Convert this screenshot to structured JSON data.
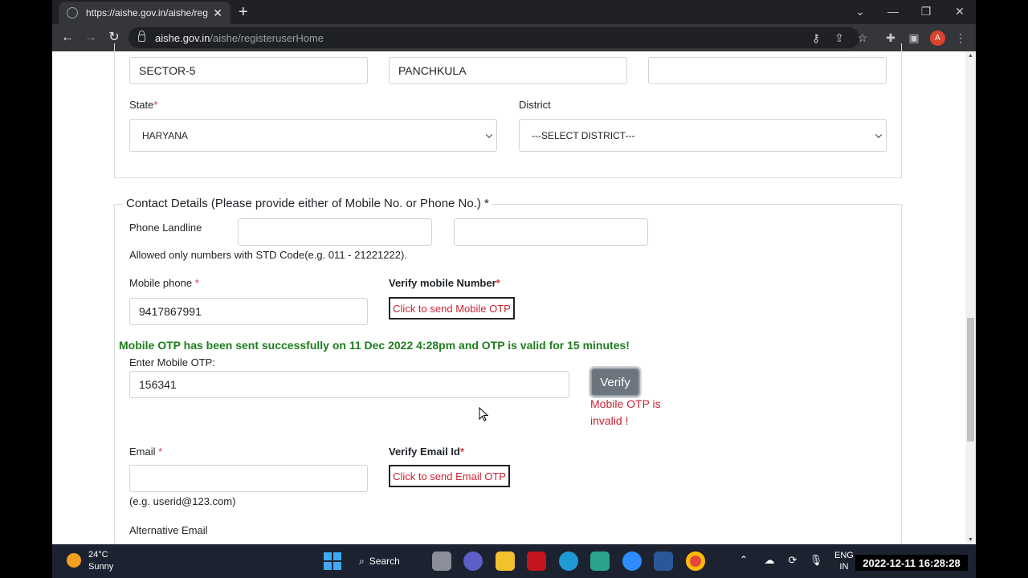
{
  "browser": {
    "tab_title": "https://aishe.gov.in/aishe/registe",
    "tab_close": "✕",
    "new_tab": "+",
    "url_domain": "aishe.gov.in",
    "url_path": "/aishe/registeruserHome",
    "profile_initial": "A"
  },
  "address": {
    "line_value": "SECTOR-5",
    "city_value": "PANCHKULA",
    "pin_value": "",
    "state_label": "State",
    "state_value": "HARYANA",
    "district_label": "District",
    "district_value": "---SELECT DISTRICT---"
  },
  "contact": {
    "legend": "Contact Details (Please provide either of Mobile No. or Phone No.) *",
    "phone_label": "Phone Landline",
    "std_value": "",
    "phone_value": "",
    "phone_help": "Allowed only numbers with STD Code(e.g. 011 - 21221222).",
    "mobile_label": "Mobile phone",
    "mobile_value": "9417867991",
    "verify_mobile_label": "Verify mobile Number",
    "send_mobile_otp": "Click to send Mobile OTP",
    "otp_success": "Mobile OTP has been sent successfully on 11 Dec 2022 4:28pm and OTP is valid for 15 minutes!",
    "enter_otp_label": "Enter Mobile OTP:",
    "otp_value": "156341",
    "verify_button": "Verify",
    "otp_error_line1": "Mobile OTP is",
    "otp_error_line2": "invalid !",
    "email_label": "Email",
    "email_value": "",
    "verify_email_label": "Verify Email Id",
    "send_email_otp": "Click to send Email OTP",
    "email_help": "(e.g. userid@123.com)",
    "alt_email_label": "Alternative Email",
    "required_mark": "*"
  },
  "taskbar": {
    "temperature": "24°C",
    "weather": "Sunny",
    "search": "Search",
    "lang_line1": "ENG",
    "lang_line2": "IN",
    "clock": "2022-12-11  16:28:28"
  },
  "colors": {
    "error_red": "#c82333",
    "success_green": "#1e7e1e",
    "verify_grey": "#6c757d"
  }
}
